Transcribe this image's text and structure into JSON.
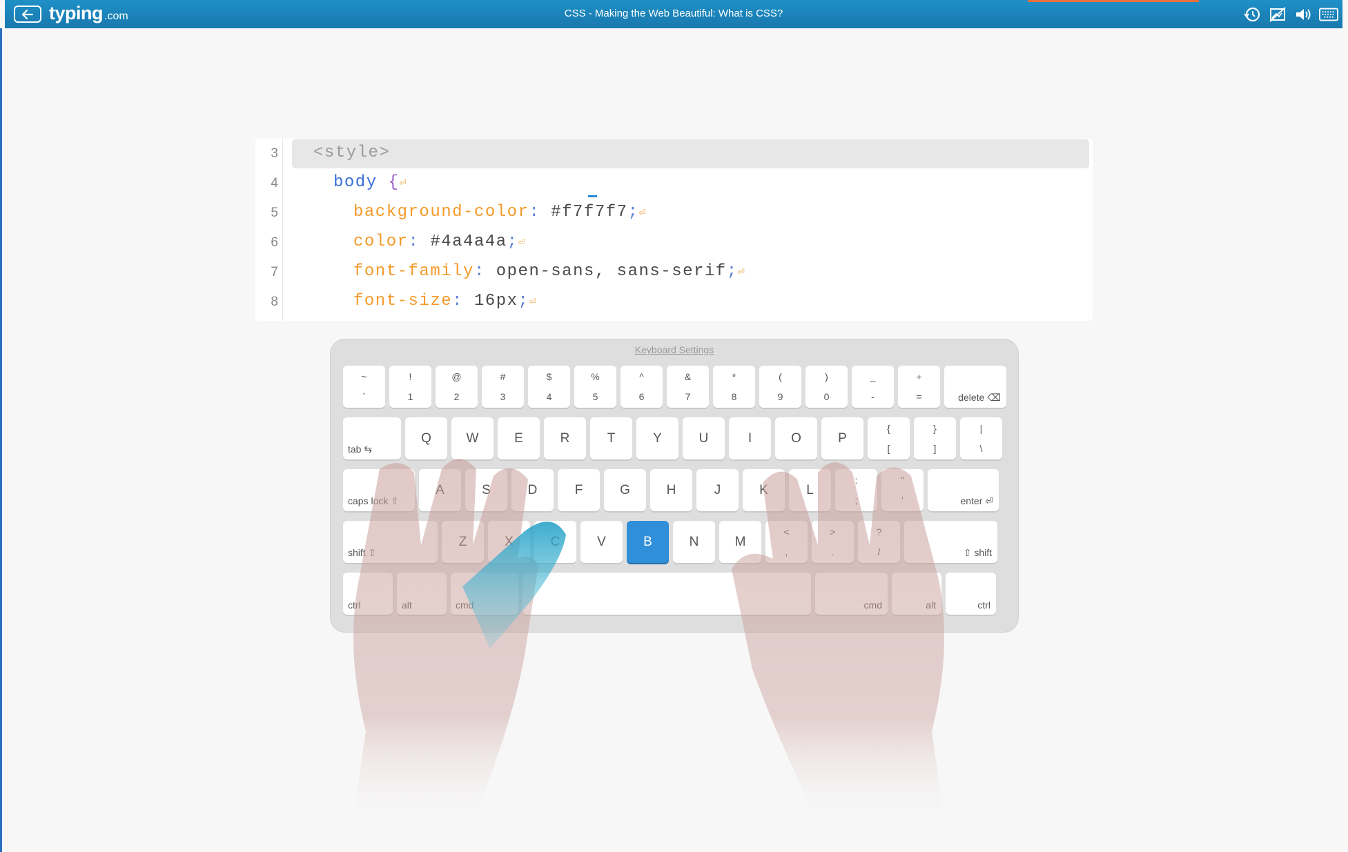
{
  "header": {
    "logo_main": "typing",
    "logo_tld": ".com",
    "lesson_title": "CSS - Making the Web Beautiful: What is CSS?",
    "icons": [
      "back-arrow-icon",
      "history-icon",
      "no-graphics-icon",
      "volume-icon",
      "keyboard-icon"
    ]
  },
  "code": {
    "lines": [
      {
        "num": "3",
        "parts": [
          {
            "t": "<style>",
            "c": "c-tag"
          }
        ]
      },
      {
        "num": "4",
        "parts": [
          {
            "t": "body",
            "c": "c-sel"
          },
          {
            "t": " {",
            "c": "c-brace"
          },
          {
            "t": "⏎",
            "c": "c-ret"
          }
        ]
      },
      {
        "num": "5",
        "parts": [
          {
            "t": "background-color",
            "c": "c-prop"
          },
          {
            "t": ": ",
            "c": "c-colon"
          },
          {
            "t": "#f7f7f7",
            "c": "c-val"
          },
          {
            "t": ";",
            "c": "c-colon"
          },
          {
            "t": "⏎",
            "c": "c-ret"
          }
        ]
      },
      {
        "num": "6",
        "parts": [
          {
            "t": "color",
            "c": "c-prop"
          },
          {
            "t": ": ",
            "c": "c-colon"
          },
          {
            "t": "#4a4a4a",
            "c": "c-val"
          },
          {
            "t": ";",
            "c": "c-colon"
          },
          {
            "t": "⏎",
            "c": "c-ret"
          }
        ]
      },
      {
        "num": "7",
        "parts": [
          {
            "t": "font-family",
            "c": "c-prop"
          },
          {
            "t": ": ",
            "c": "c-colon"
          },
          {
            "t": "open-sans, sans-serif",
            "c": "c-val"
          },
          {
            "t": ";",
            "c": "c-colon"
          },
          {
            "t": "⏎",
            "c": "c-ret"
          }
        ]
      },
      {
        "num": "8",
        "parts": [
          {
            "t": "font-size",
            "c": "c-prop"
          },
          {
            "t": ": ",
            "c": "c-colon"
          },
          {
            "t": "16px",
            "c": "c-val"
          },
          {
            "t": ";",
            "c": "c-colon"
          },
          {
            "t": "⏎",
            "c": "c-ret"
          }
        ]
      }
    ]
  },
  "keyboard": {
    "settings_label": "Keyboard Settings",
    "active_key": "B",
    "rows": [
      [
        {
          "top": "~",
          "bot": "`"
        },
        {
          "top": "!",
          "bot": "1"
        },
        {
          "top": "@",
          "bot": "2"
        },
        {
          "top": "#",
          "bot": "3"
        },
        {
          "top": "$",
          "bot": "4"
        },
        {
          "top": "%",
          "bot": "5"
        },
        {
          "top": "^",
          "bot": "6"
        },
        {
          "top": "&",
          "bot": "7"
        },
        {
          "top": "*",
          "bot": "8"
        },
        {
          "top": "(",
          "bot": "9"
        },
        {
          "top": ")",
          "bot": "0"
        },
        {
          "top": "_",
          "bot": "-"
        },
        {
          "top": "+",
          "bot": "="
        },
        {
          "right": "delete ⌫"
        }
      ],
      [
        {
          "left": "tab ⇆"
        },
        {
          "mid": "Q"
        },
        {
          "mid": "W"
        },
        {
          "mid": "E"
        },
        {
          "mid": "R"
        },
        {
          "mid": "T"
        },
        {
          "mid": "Y"
        },
        {
          "mid": "U"
        },
        {
          "mid": "I"
        },
        {
          "mid": "O"
        },
        {
          "mid": "P"
        },
        {
          "top": "{",
          "bot": "["
        },
        {
          "top": "}",
          "bot": "]"
        },
        {
          "top": "|",
          "bot": "\\"
        }
      ],
      [
        {
          "left": "caps lock ⇧"
        },
        {
          "mid": "A"
        },
        {
          "mid": "S"
        },
        {
          "mid": "D"
        },
        {
          "mid": "F"
        },
        {
          "mid": "G"
        },
        {
          "mid": "H"
        },
        {
          "mid": "J"
        },
        {
          "mid": "K"
        },
        {
          "mid": "L"
        },
        {
          "top": ":",
          "bot": ";"
        },
        {
          "top": "\"",
          "bot": "'"
        },
        {
          "right": "enter ⏎"
        }
      ],
      [
        {
          "left": "shift ⇧"
        },
        {
          "mid": "Z"
        },
        {
          "mid": "X"
        },
        {
          "mid": "C"
        },
        {
          "mid": "V"
        },
        {
          "mid": "B"
        },
        {
          "mid": "N"
        },
        {
          "mid": "M"
        },
        {
          "top": "<",
          "bot": ","
        },
        {
          "top": ">",
          "bot": "."
        },
        {
          "top": "?",
          "bot": "/"
        },
        {
          "right": "⇧ shift"
        }
      ],
      [
        {
          "left": "ctrl"
        },
        {
          "left": "alt"
        },
        {
          "left": "cmd"
        },
        {
          "mid": ""
        },
        {
          "right": "cmd"
        },
        {
          "right": "alt"
        },
        {
          "right": "ctrl"
        }
      ]
    ]
  },
  "colors": {
    "topbar": "#1a84bb",
    "active_key": "#2f8fd8",
    "property": "#f49a2a",
    "selector": "#3b6fd8"
  }
}
